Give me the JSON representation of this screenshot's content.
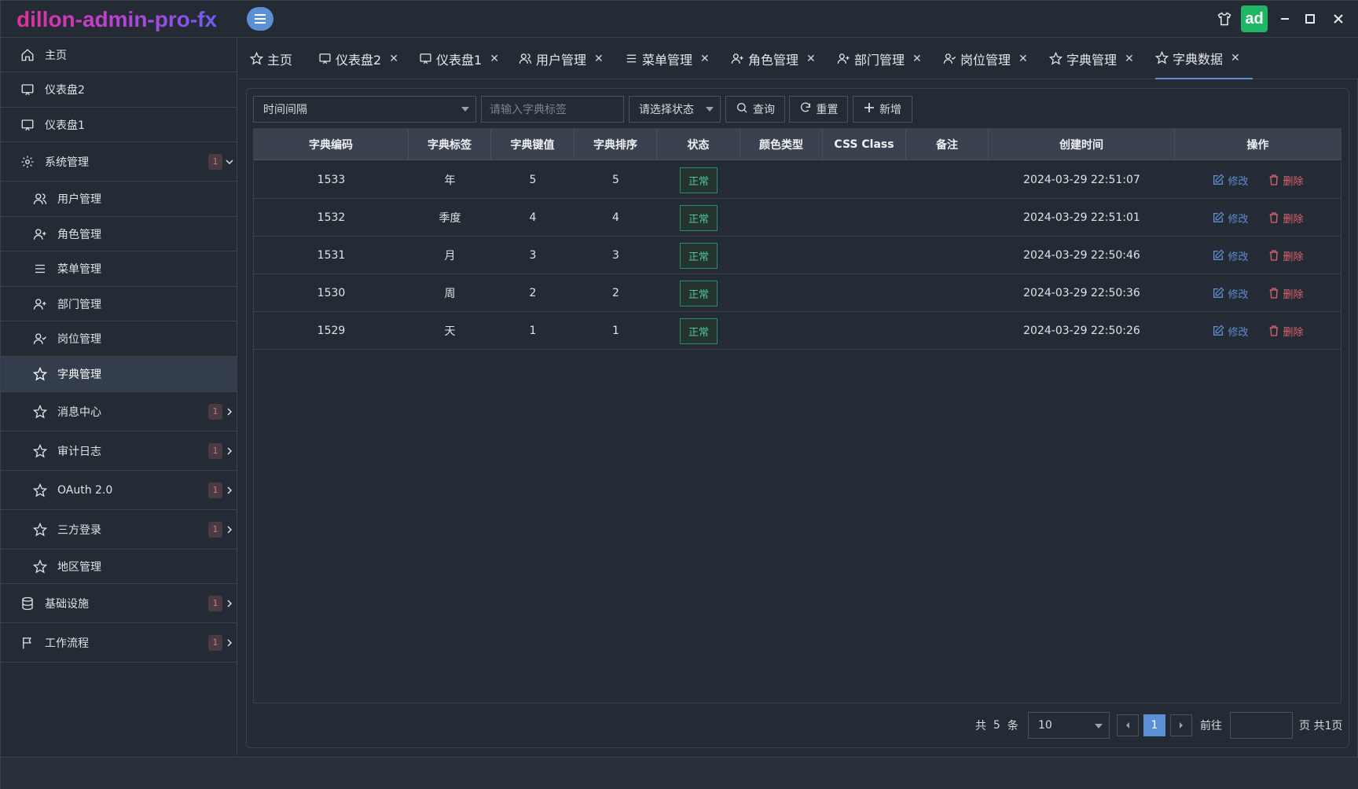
{
  "app": {
    "title": "dillon-admin-pro-fx",
    "avatar_text": "ad"
  },
  "sidebar": {
    "items": [
      {
        "label": "主页",
        "icon": "home-icon"
      },
      {
        "label": "仪表盘2",
        "icon": "monitor-icon"
      },
      {
        "label": "仪表盘1",
        "icon": "monitor-icon"
      },
      {
        "label": "系统管理",
        "icon": "gear-icon",
        "badge": "1",
        "expanded": true
      },
      {
        "label": "用户管理",
        "icon": "users-icon"
      },
      {
        "label": "角色管理",
        "icon": "user-plus-icon"
      },
      {
        "label": "菜单管理",
        "icon": "list-icon"
      },
      {
        "label": "部门管理",
        "icon": "user-plus-icon"
      },
      {
        "label": "岗位管理",
        "icon": "user-check-icon"
      },
      {
        "label": "字典管理",
        "icon": "star-icon",
        "active": true
      },
      {
        "label": "消息中心",
        "icon": "star-icon",
        "badge": "1"
      },
      {
        "label": "审计日志",
        "icon": "star-icon",
        "badge": "1"
      },
      {
        "label": "OAuth 2.0",
        "icon": "star-icon",
        "badge": "1"
      },
      {
        "label": "三方登录",
        "icon": "star-icon",
        "badge": "1"
      },
      {
        "label": "地区管理",
        "icon": "star-icon"
      },
      {
        "label": "基础设施",
        "icon": "database-icon",
        "badge": "1"
      },
      {
        "label": "工作流程",
        "icon": "flag-icon",
        "badge": "1"
      }
    ]
  },
  "tabs": [
    {
      "label": "主页",
      "icon": "star-icon",
      "closable": false
    },
    {
      "label": "仪表盘2",
      "icon": "monitor-icon",
      "closable": true
    },
    {
      "label": "仪表盘1",
      "icon": "monitor-icon",
      "closable": true
    },
    {
      "label": "用户管理",
      "icon": "users-icon",
      "closable": true
    },
    {
      "label": "菜单管理",
      "icon": "list-icon",
      "closable": true
    },
    {
      "label": "角色管理",
      "icon": "user-plus-icon",
      "closable": true
    },
    {
      "label": "部门管理",
      "icon": "user-plus-icon",
      "closable": true
    },
    {
      "label": "岗位管理",
      "icon": "user-check-icon",
      "closable": true
    },
    {
      "label": "字典管理",
      "icon": "star-icon",
      "closable": true
    },
    {
      "label": "字典数据",
      "icon": "star-icon",
      "closable": true,
      "active": true
    }
  ],
  "toolbar": {
    "interval_select": "时间间隔",
    "label_placeholder": "请输入字典标签",
    "status_select": "请选择状态",
    "query_label": "查询",
    "reset_label": "重置",
    "add_label": "新增"
  },
  "table": {
    "columns": [
      "字典编码",
      "字典标签",
      "字典键值",
      "字典排序",
      "状态",
      "颜色类型",
      "CSS Class",
      "备注",
      "创建时间",
      "操作"
    ],
    "rows": [
      {
        "code": "1533",
        "label": "年",
        "value": "5",
        "sort": "5",
        "status": "正常",
        "color_type": "",
        "css_class": "",
        "remark": "",
        "created": "2024-03-29 22:51:07"
      },
      {
        "code": "1532",
        "label": "季度",
        "value": "4",
        "sort": "4",
        "status": "正常",
        "color_type": "",
        "css_class": "",
        "remark": "",
        "created": "2024-03-29 22:51:01"
      },
      {
        "code": "1531",
        "label": "月",
        "value": "3",
        "sort": "3",
        "status": "正常",
        "color_type": "",
        "css_class": "",
        "remark": "",
        "created": "2024-03-29 22:50:46"
      },
      {
        "code": "1530",
        "label": "周",
        "value": "2",
        "sort": "2",
        "status": "正常",
        "color_type": "",
        "css_class": "",
        "remark": "",
        "created": "2024-03-29 22:50:36"
      },
      {
        "code": "1529",
        "label": "天",
        "value": "1",
        "sort": "1",
        "status": "正常",
        "color_type": "",
        "css_class": "",
        "remark": "",
        "created": "2024-03-29 22:50:26"
      }
    ],
    "edit_label": "修改",
    "delete_label": "删除"
  },
  "pagination": {
    "total_prefix": "共",
    "total": "5",
    "total_suffix": "条",
    "page_size": "10",
    "current_page": "1",
    "goto_label": "前往",
    "pages_label": "页 共1页"
  },
  "colors": {
    "accent": "#5b8fd6",
    "success": "#4fc3a1",
    "danger": "#d9646f",
    "brand_gradient": [
      "#e0309a",
      "#6f5cf0"
    ]
  }
}
